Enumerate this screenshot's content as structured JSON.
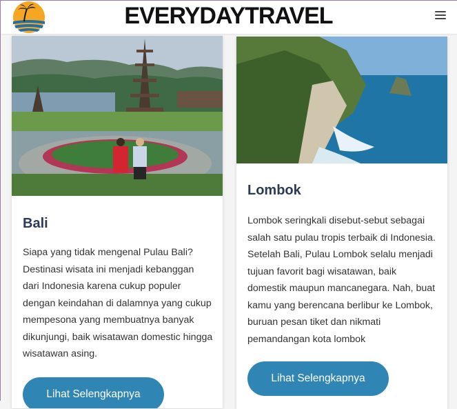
{
  "header": {
    "brand": "EVERYDAYTRAVEL",
    "logo_icon": "sunset-palm-logo-icon",
    "menu_icon": "hamburger-menu-icon"
  },
  "cards": [
    {
      "title": "Bali",
      "text": "Siapa yang tidak mengenal Pulau Bali? Destinasi wisata ini menjadi kebanggan dari Indonesia karena cukup populer dengan keindahan di dalamnya yang cukup mempesona yang membuatnya banyak dikunjungi, baik wisatawan domestic hingga wisatawan asing.",
      "button": "Lihat Selengkapnya"
    },
    {
      "title": "Lombok",
      "text": "Lombok seringkali disebut-sebut sebagai salah satu pulau tropis terbaik di Indonesia. Setelah Bali, Pulau Lombok selalu menjadi tujuan favorit bagi wisatawan, baik domestik maupun mancanegara. Nah, buat kamu yang berencana berlibur ke Lombok, buruan pesan tiket dan nikmati pemandangan kota lombok",
      "button": "Lihat Selengkapnya"
    }
  ],
  "colors": {
    "accent": "#2f86b5",
    "title": "#2b3a55",
    "logo_sun": "#f5a623"
  }
}
